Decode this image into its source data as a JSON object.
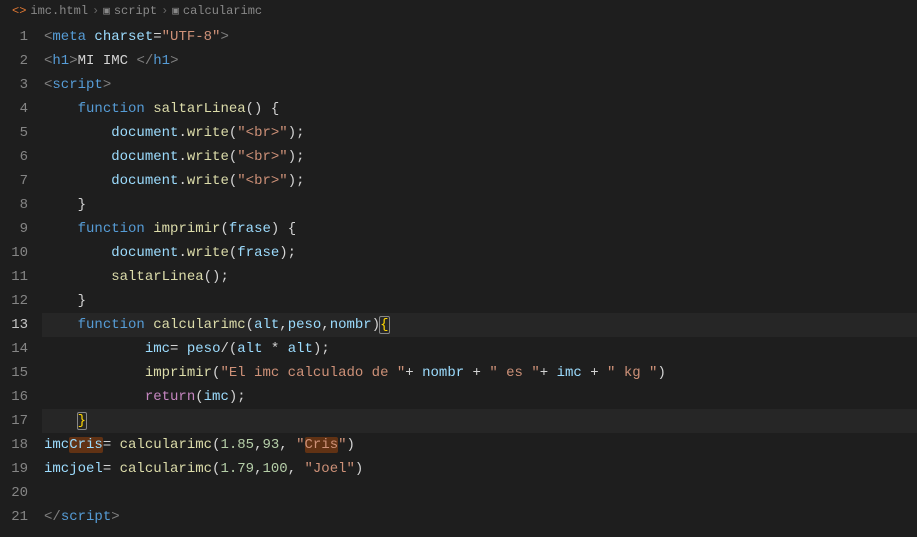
{
  "breadcrumb": {
    "file_icon": "<>",
    "file": "imc.html",
    "sep": "›",
    "scope1_icon": "▣",
    "scope1": "script",
    "scope2_icon": "▣",
    "scope2": "calcularimc"
  },
  "active_line": 13,
  "gutter": [
    "1",
    "2",
    "3",
    "4",
    "5",
    "6",
    "7",
    "8",
    "9",
    "10",
    "11",
    "12",
    "13",
    "14",
    "15",
    "16",
    "17",
    "18",
    "19",
    "20",
    "21"
  ],
  "code_lines": {
    "l1": [
      [
        "tk-gray",
        "<"
      ],
      [
        "tk-tag",
        "meta"
      ],
      [
        "tk-text",
        " "
      ],
      [
        "tk-attr",
        "charset"
      ],
      [
        "tk-text",
        "="
      ],
      [
        "tk-str",
        "\"UTF-8\""
      ],
      [
        "tk-gray",
        ">"
      ]
    ],
    "l2": [
      [
        "tk-gray",
        "<"
      ],
      [
        "tk-tag",
        "h1"
      ],
      [
        "tk-gray",
        ">"
      ],
      [
        "tk-text",
        "MI IMC "
      ],
      [
        "tk-gray",
        "</"
      ],
      [
        "tk-tag",
        "h1"
      ],
      [
        "tk-gray",
        ">"
      ]
    ],
    "l3": [
      [
        "tk-gray",
        "<"
      ],
      [
        "tk-tag",
        "script"
      ],
      [
        "tk-gray",
        ">"
      ]
    ],
    "l4": [
      [
        "tk-text",
        "    "
      ],
      [
        "tk-kw",
        "function"
      ],
      [
        "tk-text",
        " "
      ],
      [
        "tk-fn",
        "saltarLinea"
      ],
      [
        "tk-punc",
        "()"
      ],
      [
        "tk-text",
        " "
      ],
      [
        "tk-punc",
        "{"
      ]
    ],
    "l5": [
      [
        "tk-text",
        "        "
      ],
      [
        "tk-var",
        "document"
      ],
      [
        "tk-punc",
        "."
      ],
      [
        "tk-fn",
        "write"
      ],
      [
        "tk-punc",
        "("
      ],
      [
        "tk-str",
        "\"<br>\""
      ],
      [
        "tk-punc",
        ");"
      ]
    ],
    "l6": [
      [
        "tk-text",
        "        "
      ],
      [
        "tk-var",
        "document"
      ],
      [
        "tk-punc",
        "."
      ],
      [
        "tk-fn",
        "write"
      ],
      [
        "tk-punc",
        "("
      ],
      [
        "tk-str",
        "\"<br>\""
      ],
      [
        "tk-punc",
        ");"
      ]
    ],
    "l7": [
      [
        "tk-text",
        "        "
      ],
      [
        "tk-var",
        "document"
      ],
      [
        "tk-punc",
        "."
      ],
      [
        "tk-fn",
        "write"
      ],
      [
        "tk-punc",
        "("
      ],
      [
        "tk-str",
        "\"<br>\""
      ],
      [
        "tk-punc",
        ");"
      ]
    ],
    "l8": [
      [
        "tk-text",
        "    "
      ],
      [
        "tk-punc",
        "}"
      ]
    ],
    "l9": [
      [
        "tk-text",
        "    "
      ],
      [
        "tk-kw",
        "function"
      ],
      [
        "tk-text",
        " "
      ],
      [
        "tk-fn",
        "imprimir"
      ],
      [
        "tk-punc",
        "("
      ],
      [
        "tk-var",
        "frase"
      ],
      [
        "tk-punc",
        ")"
      ],
      [
        "tk-text",
        " "
      ],
      [
        "tk-punc",
        "{"
      ]
    ],
    "l10": [
      [
        "tk-text",
        "        "
      ],
      [
        "tk-var",
        "document"
      ],
      [
        "tk-punc",
        "."
      ],
      [
        "tk-fn",
        "write"
      ],
      [
        "tk-punc",
        "("
      ],
      [
        "tk-var",
        "frase"
      ],
      [
        "tk-punc",
        ");"
      ]
    ],
    "l11": [
      [
        "tk-text",
        "        "
      ],
      [
        "tk-fn",
        "saltarLinea"
      ],
      [
        "tk-punc",
        "();"
      ]
    ],
    "l12": [
      [
        "tk-text",
        "    "
      ],
      [
        "tk-punc",
        "}"
      ]
    ],
    "l13": [
      [
        "tk-text",
        "    "
      ],
      [
        "tk-kw",
        "function"
      ],
      [
        "tk-text",
        " "
      ],
      [
        "tk-fn",
        "calcularimc"
      ],
      [
        "tk-punc",
        "("
      ],
      [
        "tk-var",
        "alt"
      ],
      [
        "tk-punc",
        ","
      ],
      [
        "tk-var",
        "peso"
      ],
      [
        "tk-punc",
        ","
      ],
      [
        "tk-var",
        "nombr"
      ],
      [
        "tk-punc",
        ")"
      ],
      [
        "bracket-box tk-brace",
        "{"
      ]
    ],
    "l14": [
      [
        "tk-text",
        "            "
      ],
      [
        "tk-var",
        "imc"
      ],
      [
        "tk-punc",
        "= "
      ],
      [
        "tk-var",
        "peso"
      ],
      [
        "tk-punc",
        "/("
      ],
      [
        "tk-var",
        "alt"
      ],
      [
        "tk-punc",
        " * "
      ],
      [
        "tk-var",
        "alt"
      ],
      [
        "tk-punc",
        ");"
      ]
    ],
    "l15": [
      [
        "tk-text",
        "            "
      ],
      [
        "tk-fn",
        "imprimir"
      ],
      [
        "tk-punc",
        "("
      ],
      [
        "tk-str",
        "\"El imc calculado de \""
      ],
      [
        "tk-punc",
        "+ "
      ],
      [
        "tk-var",
        "nombr"
      ],
      [
        "tk-punc",
        " + "
      ],
      [
        "tk-str",
        "\" es \""
      ],
      [
        "tk-punc",
        "+ "
      ],
      [
        "tk-var",
        "imc"
      ],
      [
        "tk-punc",
        " + "
      ],
      [
        "tk-str",
        "\" kg \""
      ],
      [
        "tk-punc",
        ")"
      ]
    ],
    "l16": [
      [
        "tk-text",
        "            "
      ],
      [
        "tk-kw2",
        "return"
      ],
      [
        "tk-punc",
        "("
      ],
      [
        "tk-var",
        "imc"
      ],
      [
        "tk-punc",
        ");"
      ]
    ],
    "l17": [
      [
        "tk-text",
        "    "
      ],
      [
        "bracket-box tk-brace",
        "}"
      ]
    ],
    "l18": [
      [
        "tk-var",
        "imc"
      ],
      [
        "hl-ref tk-var",
        "Cris"
      ],
      [
        "tk-punc",
        "= "
      ],
      [
        "tk-fn",
        "calcularimc"
      ],
      [
        "tk-punc",
        "("
      ],
      [
        "tk-num",
        "1.85"
      ],
      [
        "tk-punc",
        ","
      ],
      [
        "tk-num",
        "93"
      ],
      [
        "tk-punc",
        ", "
      ],
      [
        "tk-str",
        "\""
      ],
      [
        "hl-ref tk-str",
        "Cris"
      ],
      [
        "tk-str",
        "\""
      ],
      [
        "tk-punc",
        ")"
      ]
    ],
    "l19": [
      [
        "tk-var",
        "imcjoel"
      ],
      [
        "tk-punc",
        "= "
      ],
      [
        "tk-fn",
        "calcularimc"
      ],
      [
        "tk-punc",
        "("
      ],
      [
        "tk-num",
        "1.79"
      ],
      [
        "tk-punc",
        ","
      ],
      [
        "tk-num",
        "100"
      ],
      [
        "tk-punc",
        ", "
      ],
      [
        "tk-str",
        "\"Joel\""
      ],
      [
        "tk-punc",
        ")"
      ]
    ],
    "l20": [
      [
        "tk-text",
        ""
      ]
    ],
    "l21": [
      [
        "tk-gray",
        "</"
      ],
      [
        "tk-tag",
        "script"
      ],
      [
        "tk-gray",
        ">"
      ]
    ]
  }
}
